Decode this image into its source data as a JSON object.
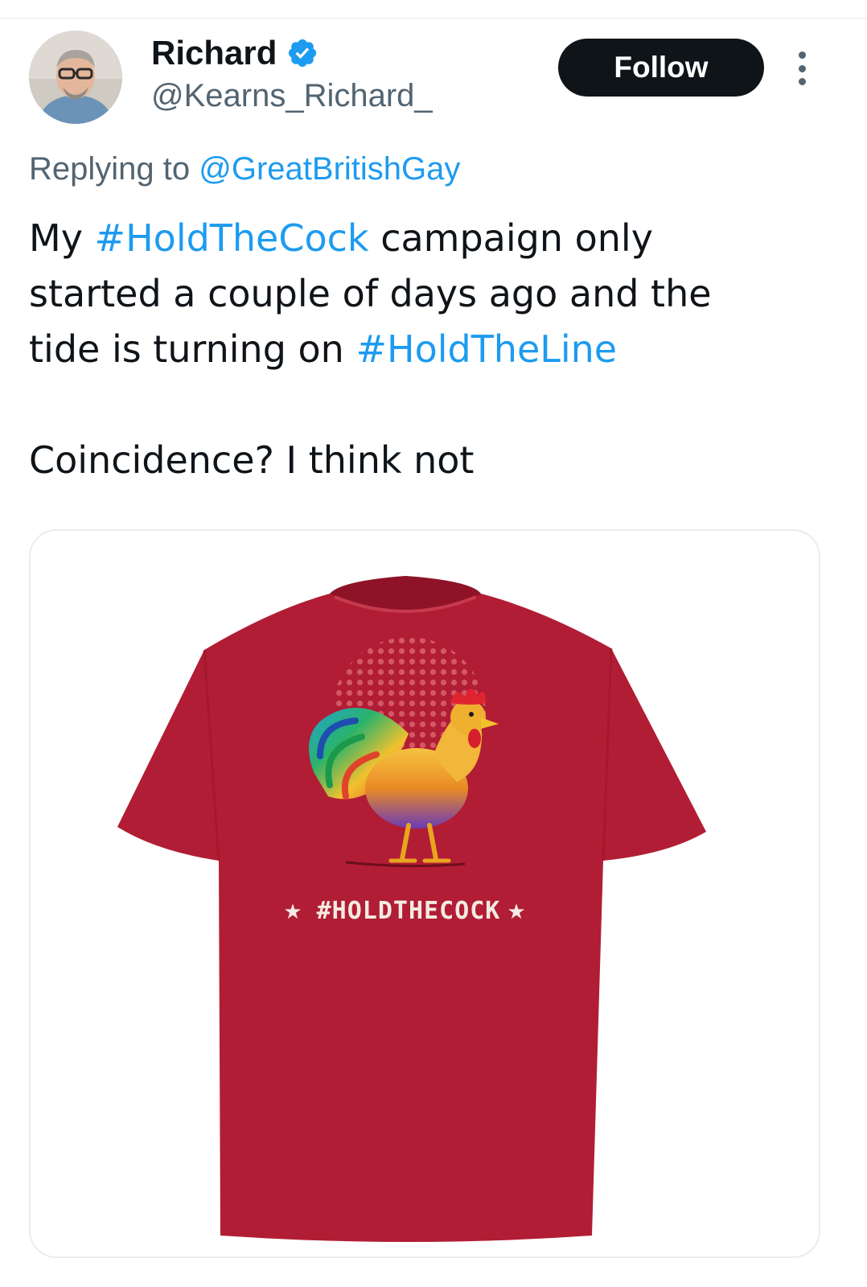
{
  "author": {
    "display_name": "Richard",
    "handle": "@Kearns_Richard_",
    "verified": true
  },
  "actions": {
    "follow_label": "Follow",
    "more_icon": "more-vertical-icon"
  },
  "reply": {
    "prefix": "Replying to",
    "to_handle": "@GreatBritishGay"
  },
  "tweet": {
    "line1_start": "My",
    "hashtag1": "#HoldTheCock",
    "line1_end": "campaign only",
    "line2": "started a couple of days ago and the",
    "line3_start": "tide is turning on",
    "hashtag2": "#HoldTheLine",
    "line4": "Coincidence? I think not"
  },
  "media": {
    "shirt_text": "#HOLDTHECOCK",
    "shirt_color": "#b11d34"
  },
  "colors": {
    "link": "#1d9bf0",
    "verified": "#1d9bf0",
    "text": "#0f1419",
    "secondary": "#536471"
  }
}
